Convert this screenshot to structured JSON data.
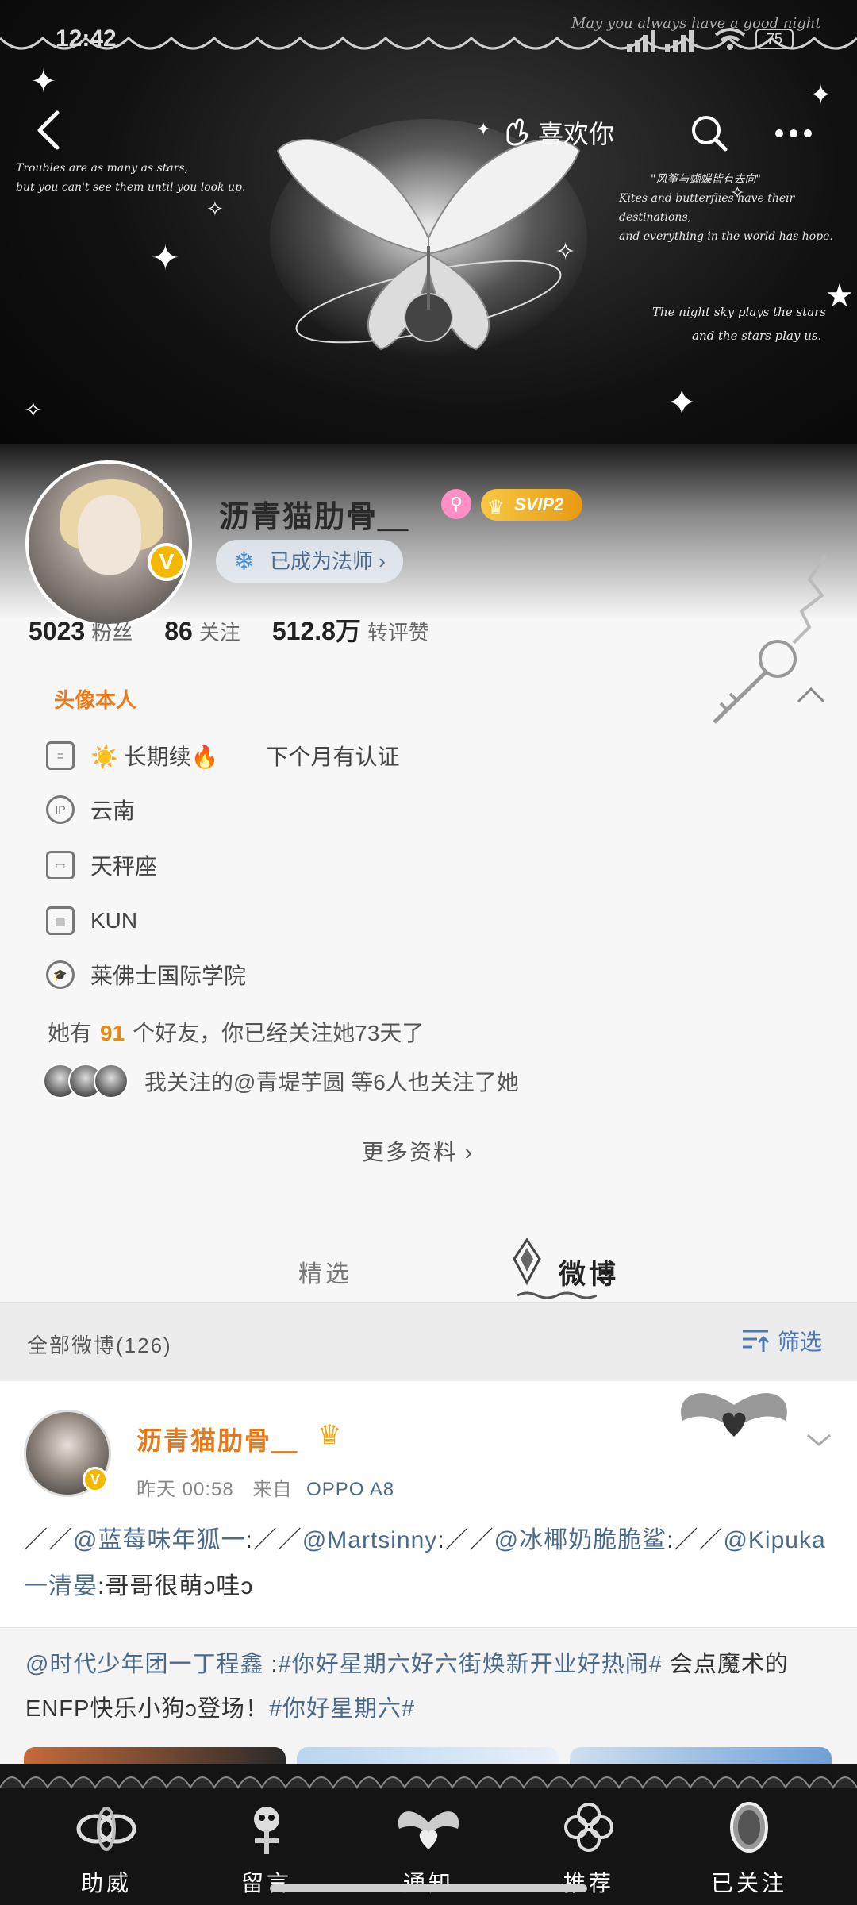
{
  "status_bar": {
    "time": "12:42",
    "battery": "75"
  },
  "nav": {
    "like_label": "喜欢你"
  },
  "banner": {
    "quote_left": [
      "Troubles are as many as stars,",
      "but you can't see them until you look up."
    ],
    "quote_right_title": "\"风筝与蝴蝶皆有去向\"",
    "quote_right": [
      "Kites and butterflies have their destinations,",
      "and everything in the world has hope."
    ],
    "quote_right2": [
      "The night sky plays the stars",
      "and the stars play us."
    ],
    "script_top": "May you always have a good night"
  },
  "profile": {
    "username": "沥青猫肋骨＿",
    "svip_label": "SVIP2",
    "magician_label": "已成为法师 ›",
    "stats": [
      {
        "num": "5023",
        "label": "粉丝"
      },
      {
        "num": "86",
        "label": "关注"
      },
      {
        "num": "512.8万",
        "label": "转评赞"
      }
    ],
    "section_title": "头像本人",
    "bio": "☀️ 长期续🔥",
    "bio_extra": "下个月有认证",
    "ip": "云南",
    "zodiac": "天秤座",
    "company": "KUN",
    "school": "莱佛士国际学院",
    "friends_prefix": "她有",
    "friends_count": "91",
    "friends_suffix": "个好友，你已经关注她73天了",
    "mutual_text": "我关注的@青堤芋圆 等6人也关注了她",
    "more_info": "更多资料 ›"
  },
  "tabs": {
    "featured": "精选",
    "weibo": "微博"
  },
  "feed": {
    "count_label": "全部微博(126)",
    "filter_label": "筛选"
  },
  "post": {
    "author": "沥青猫肋骨＿",
    "time": "昨天 00:58",
    "source_prefix": "来自",
    "source": "OPPO A8",
    "text_parts": [
      {
        "t": "／／",
        "m": false
      },
      {
        "t": "@蓝莓味年狐一",
        "m": true
      },
      {
        "t": ":／／",
        "m": false
      },
      {
        "t": "@Martsinny",
        "m": true
      },
      {
        "t": ":／／",
        "m": false
      },
      {
        "t": "@冰椰奶脆脆鲨",
        "m": true
      },
      {
        "t": ":／／",
        "m": false
      },
      {
        "t": "@Kipuka一清晏",
        "m": true
      },
      {
        "t": ":哥哥很萌ↄ哇ↄ",
        "m": false
      }
    ]
  },
  "repost": {
    "text_parts": [
      {
        "t": "@时代少年团一丁程鑫",
        "m": true
      },
      {
        "t": " :",
        "m": false
      },
      {
        "t": "#你好星期六好六街焕新开业好热闹#",
        "m": true
      },
      {
        "t": " 会点魔术的ENFP快乐小狗ↄ登场！",
        "m": false
      },
      {
        "t": "#你好星期六#",
        "m": true
      }
    ]
  },
  "bottom_nav": [
    {
      "label": "助威",
      "icon": "knot-icon"
    },
    {
      "label": "留言",
      "icon": "skull-icon"
    },
    {
      "label": "通知",
      "icon": "heart-wings-icon"
    },
    {
      "label": "推荐",
      "icon": "clover-icon"
    },
    {
      "label": "已关注",
      "icon": "mirror-icon"
    }
  ],
  "colors": {
    "accent_orange": "#e6791a",
    "mention_blue": "#4a6a8c",
    "vip_gold": "#f5b800"
  }
}
